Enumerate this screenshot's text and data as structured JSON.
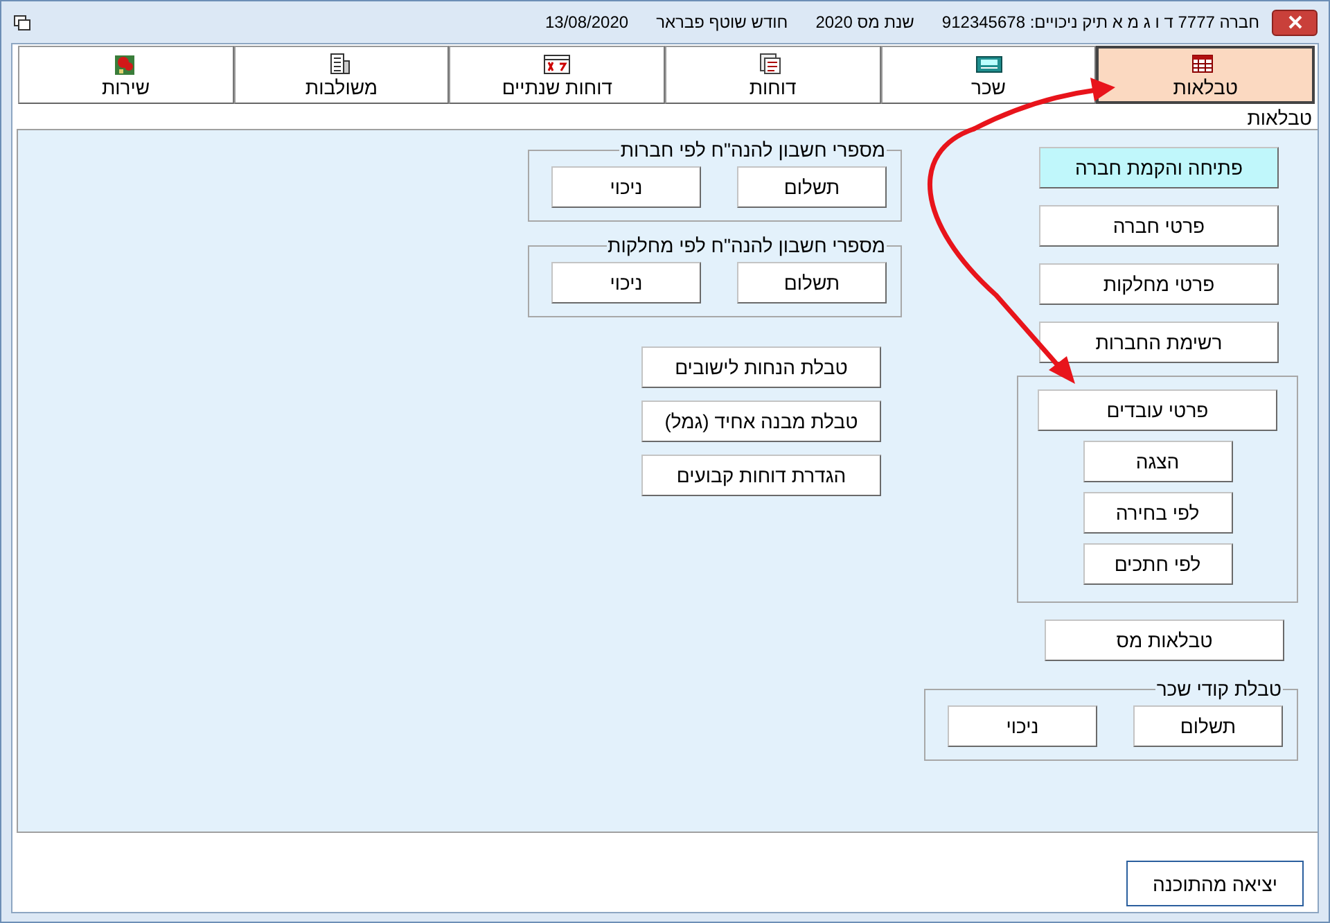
{
  "window": {
    "title_parts": [
      "חברה 7777 ד ו ג מ א תיק ניכויים: 912345678",
      "שנת מס 2020",
      "חודש שוטף פבראר",
      "13/08/2020"
    ]
  },
  "tabs": [
    {
      "label": "טבלאות",
      "selected": true
    },
    {
      "label": "שכר",
      "selected": false
    },
    {
      "label": "דוחות",
      "selected": false
    },
    {
      "label": "דוחות שנתיים",
      "selected": false
    },
    {
      "label": "משולבות",
      "selected": false
    },
    {
      "label": "שירות",
      "selected": false
    }
  ],
  "section_title": "טבלאות",
  "right_column": [
    {
      "kind": "button",
      "label": "פתיחה והקמת חברה",
      "highlighted": true
    },
    {
      "kind": "button",
      "label": "פרטי חברה",
      "highlighted": false
    },
    {
      "kind": "button",
      "label": "פרטי מחלקות",
      "highlighted": false
    },
    {
      "kind": "button",
      "label": "רשימת החברות",
      "highlighted": false
    },
    {
      "kind": "stack_group",
      "main_button": "פרטי עובדים",
      "sub_buttons": [
        "הצגה",
        "לפי בחירה",
        "לפי חתכים"
      ]
    },
    {
      "kind": "button",
      "label": "טבלאות מס",
      "highlighted": false
    },
    {
      "kind": "pair_group",
      "legend": "טבלת קודי שכר",
      "buttons": [
        "תשלום",
        "ניכוי"
      ]
    }
  ],
  "middle_column": [
    {
      "kind": "pair_group",
      "legend": "מספרי חשבון להנה\"ח לפי חברות",
      "buttons": [
        "תשלום",
        "ניכוי"
      ]
    },
    {
      "kind": "pair_group",
      "legend": "מספרי חשבון להנה\"ח לפי מחלקות",
      "buttons": [
        "תשלום",
        "ניכוי"
      ]
    },
    {
      "kind": "button",
      "label": "טבלת הנחות לישובים",
      "highlighted": false
    },
    {
      "kind": "button",
      "label": "טבלת מבנה אחיד (גמל)",
      "highlighted": false
    },
    {
      "kind": "button",
      "label": "הגדרת דוחות קבועים",
      "highlighted": false
    }
  ],
  "exit_button": "יציאה מהתוכנה"
}
